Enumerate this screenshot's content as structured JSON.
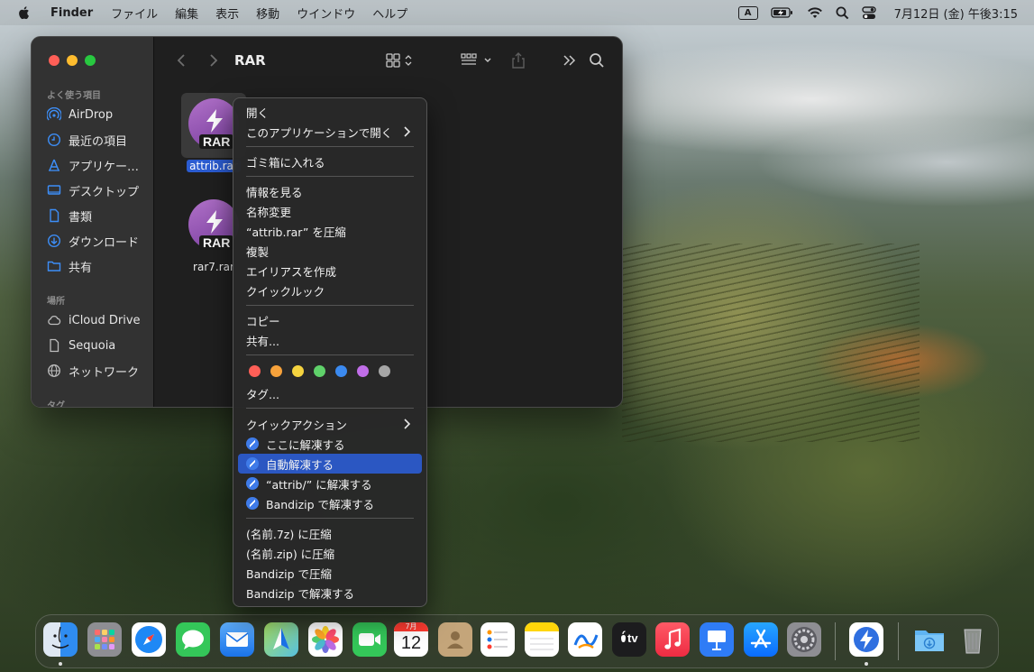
{
  "menubar": {
    "app_name": "Finder",
    "menus": [
      "ファイル",
      "編集",
      "表示",
      "移動",
      "ウインドウ",
      "ヘルプ"
    ],
    "input_source": "A",
    "clock": "7月12日 (金)  午後3:15"
  },
  "window": {
    "title": "RAR",
    "sidebar": {
      "favorites_header": "よく使う項目",
      "favorites": [
        {
          "label": "AirDrop",
          "icon": "airdrop-icon"
        },
        {
          "label": "最近の項目",
          "icon": "clock-icon"
        },
        {
          "label": "アプリケー…",
          "icon": "applications-icon"
        },
        {
          "label": "デスクトップ",
          "icon": "desktop-icon"
        },
        {
          "label": "書類",
          "icon": "document-icon"
        },
        {
          "label": "ダウンロード",
          "icon": "download-icon"
        },
        {
          "label": "共有",
          "icon": "shared-folder-icon"
        }
      ],
      "locations_header": "場所",
      "locations": [
        {
          "label": "iCloud Drive",
          "icon": "icloud-icon"
        },
        {
          "label": "Sequoia",
          "icon": "disk-icon"
        },
        {
          "label": "ネットワーク",
          "icon": "network-icon"
        }
      ],
      "tags_header": "タグ"
    },
    "files": [
      {
        "name": "attrib.rar",
        "badge": "RAR",
        "selected": true
      },
      {
        "name": "rar7.rar",
        "badge": "RAR",
        "selected": false
      }
    ]
  },
  "context_menu": {
    "open": "開く",
    "open_with": "このアプリケーションで開く",
    "trash": "ゴミ箱に入れる",
    "get_info": "情報を見る",
    "rename": "名称変更",
    "compress": "“attrib.rar” を圧縮",
    "duplicate": "複製",
    "make_alias": "エイリアスを作成",
    "quick_look": "クイックルック",
    "copy": "コピー",
    "share": "共有...",
    "tag_colors": [
      "#ff5f57",
      "#f7a23b",
      "#f5d33f",
      "#5fd16a",
      "#3b8af0",
      "#c16ee8",
      "#a6a6a6"
    ],
    "tags": "タグ...",
    "quick_actions": "クイックアクション",
    "extract_here": "ここに解凍する",
    "auto_extract": "自動解凍する",
    "extract_to": "“attrib/” に解凍する",
    "bandizip_extract": "Bandizip で解凍する",
    "compress_7z": "(名前.7z) に圧縮",
    "compress_zip": "(名前.zip) に圧縮",
    "bandizip_compress": "Bandizip で圧縮",
    "bandizip_extract2": "Bandizip で解凍する"
  },
  "dock": {
    "calendar_month": "7月",
    "calendar_day": "12",
    "tv_label": "tv"
  }
}
